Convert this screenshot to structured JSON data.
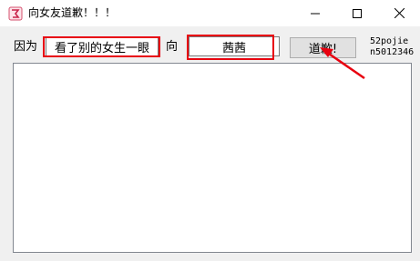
{
  "window": {
    "title": "向女友道歉！！！",
    "icon": "app-icon"
  },
  "form": {
    "because_label": "因为",
    "reason_value": "看了别的女生一眼",
    "to_label": "向",
    "name_value": "茜茜",
    "apologize_button": "道歉!"
  },
  "credit": {
    "line1": "52pojie",
    "line2": "n5012346"
  },
  "output": {
    "value": ""
  },
  "colors": {
    "annotation_red": "#e8000f",
    "button_face": "#e1e1e1"
  }
}
